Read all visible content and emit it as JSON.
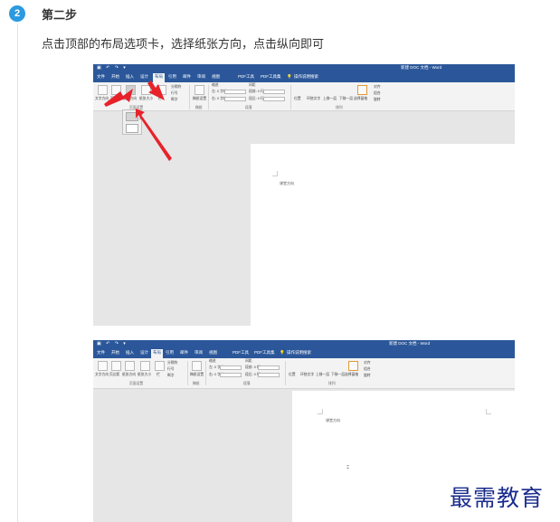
{
  "step": {
    "number": "2",
    "title": "第二步",
    "instruction": "点击顶部的布局选项卡，选择纸张方向，点击纵向即可"
  },
  "word": {
    "window_title": "新建 DOC 文档 - Word",
    "tabs": [
      "文件",
      "开始",
      "插入",
      "设计",
      "布局",
      "引用",
      "邮件",
      "审阅",
      "视图",
      "PDF工具",
      "PDF工具集",
      "操作说明搜索"
    ],
    "active_tab": "布局",
    "ribbon": {
      "text_direction": "文字方向",
      "margins": "页边距",
      "orientation": "纸张方向",
      "size": "纸张大小",
      "columns": "栏",
      "breaks": "分隔符",
      "line_numbers": "行号",
      "hyphenation": "断字",
      "page_setup_group": "页面设置",
      "manuscript": "稿纸设置",
      "manuscript_group": "稿纸",
      "indent_label": "缩进",
      "spacing_label": "间距",
      "indent_left": "左: 0 字符",
      "indent_right": "右: 0 字符",
      "spacing_before": "段前: 0 行",
      "spacing_after": "段后: 0 行",
      "paragraph_group": "段落",
      "position": "位置",
      "wrap_text": "环绕文字",
      "bring_forward": "上移一层",
      "send_backward": "下移一层",
      "selection_pane": "选择窗格",
      "align": "对齐",
      "group": "组合",
      "rotate": "旋转",
      "arrange_group": "排列"
    },
    "orientation_options": [
      "纵向",
      "横向"
    ],
    "doc_text": "课堂方向"
  },
  "watermark": "最需教育",
  "colors": {
    "badge": "#2c9ae0",
    "word_blue": "#2b579a",
    "arrow_red": "#e8222a",
    "watermark": "#1a2c8c"
  }
}
